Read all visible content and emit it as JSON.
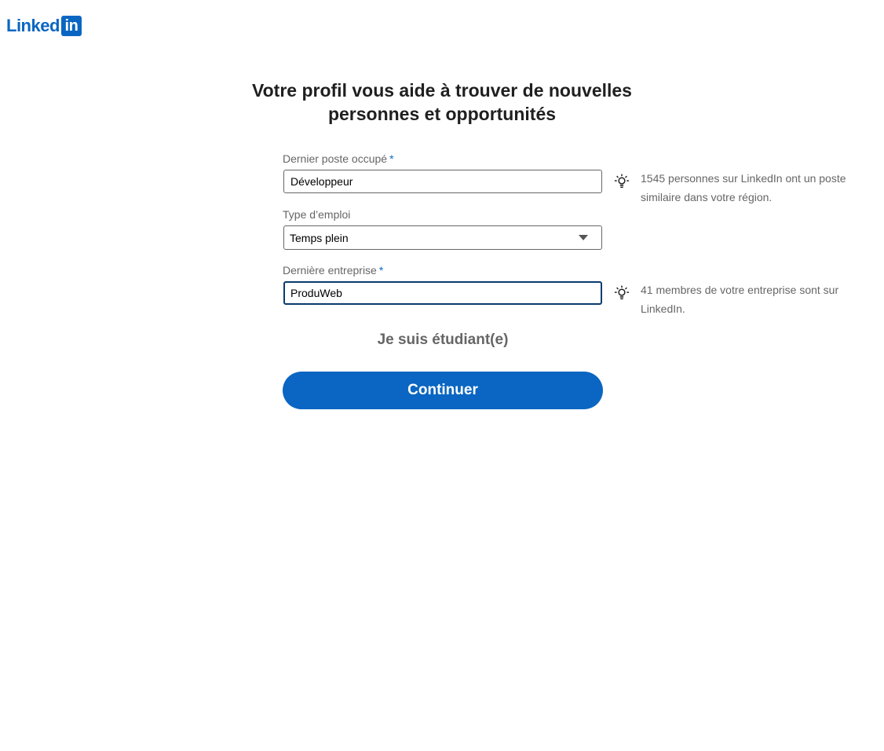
{
  "header": {
    "logo_word": "Linked",
    "logo_box": "in"
  },
  "title": {
    "line1": "Votre profil vous aide à trouver de nouvelles",
    "line2": "personnes et opportunités"
  },
  "form": {
    "job_title": {
      "label": "Dernier poste occupé",
      "required_mark": "*",
      "value": "Développeur",
      "hint": "1545 personnes sur LinkedIn ont un poste similaire dans votre région."
    },
    "employment_type": {
      "label": "Type d’emploi",
      "selected": "Temps plein"
    },
    "company": {
      "label": "Dernière entreprise",
      "required_mark": "*",
      "value": "ProduWeb",
      "hint": "41 membres de votre entreprise sont sur LinkedIn."
    },
    "student_link": "Je suis étudiant(e)",
    "continue_label": "Continuer"
  },
  "colors": {
    "brand": "#0a66c2",
    "focus_border": "#0a3b6e",
    "muted_text": "#666666"
  },
  "icons": {
    "hint": "lightbulb-icon",
    "dropdown": "chevron-down-icon"
  }
}
